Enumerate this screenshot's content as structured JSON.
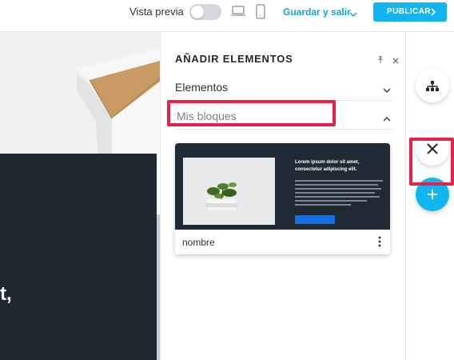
{
  "topbar": {
    "preview_label": "Vista previa",
    "preview_enabled": false,
    "save_exit_label": "Guardar y salir",
    "publish_label": "PUBLICAR"
  },
  "canvas": {
    "hero_text": "t,"
  },
  "panel": {
    "title": "AÑADIR ELEMENTOS",
    "sections": [
      {
        "label": "Elementos",
        "expanded": false
      },
      {
        "label": "Mis bloques",
        "expanded": true
      }
    ],
    "block": {
      "name": "nombre",
      "preview_heading": "Lorem ipsum dolor sit amet, consectetur adipiscing elit."
    }
  },
  "colors": {
    "accent": "#11b5f0",
    "highlight": "#e6224a",
    "dark_section": "#202932"
  },
  "icons": {
    "structure": "sitemap-icon",
    "close": "close-icon",
    "add": "plus-icon"
  }
}
